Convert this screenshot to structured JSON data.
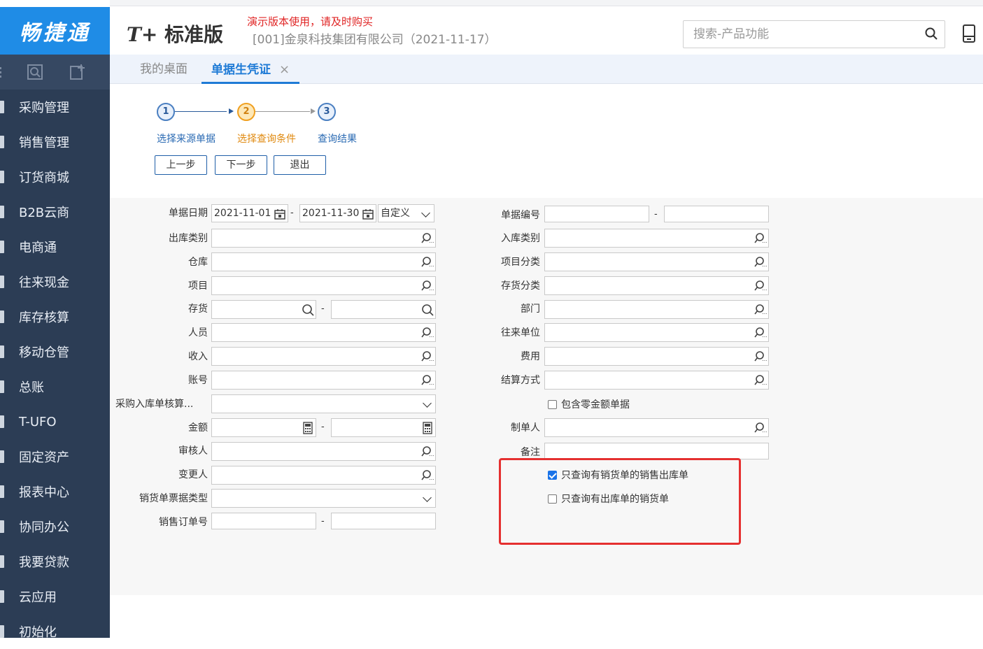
{
  "app": {
    "logo_text": "畅捷通",
    "brand_mark": "T+",
    "brand_name": "标准版",
    "demo_notice": "演示版本使用，请及时购买",
    "company": "[001]金泉科技集团有限公司（2021-11-17）",
    "search_placeholder": "搜索-产品功能"
  },
  "sidebar": {
    "items": [
      {
        "label": "采购管理"
      },
      {
        "label": "销售管理"
      },
      {
        "label": "订货商城"
      },
      {
        "label": "B2B云商"
      },
      {
        "label": "电商通"
      },
      {
        "label": "往来现金"
      },
      {
        "label": "库存核算"
      },
      {
        "label": "移动仓管"
      },
      {
        "label": "总账"
      },
      {
        "label": "T-UFO"
      },
      {
        "label": "固定资产"
      },
      {
        "label": "报表中心"
      },
      {
        "label": "协同办公"
      },
      {
        "label": "我要贷款"
      },
      {
        "label": "云应用"
      },
      {
        "label": "初始化"
      }
    ]
  },
  "tabs": [
    {
      "label": "我的桌面",
      "active": false
    },
    {
      "label": "单据生凭证",
      "active": true,
      "close": "×"
    }
  ],
  "wizard": {
    "steps": [
      {
        "num": "1",
        "label": "选择来源单据"
      },
      {
        "num": "2",
        "label": "选择查询条件"
      },
      {
        "num": "3",
        "label": "查询结果"
      }
    ],
    "current_step": 2,
    "buttons": {
      "prev": "上一步",
      "next": "下一步",
      "exit": "退出"
    }
  },
  "form": {
    "left": {
      "doc_date": {
        "label": "单据日期",
        "from": "2021-11-01",
        "to": "2021-11-30",
        "mode": "自定义"
      },
      "out_type": {
        "label": "出库类别",
        "value": ""
      },
      "warehouse": {
        "label": "仓库",
        "value": ""
      },
      "project": {
        "label": "项目",
        "value": ""
      },
      "inventory": {
        "label": "存货",
        "from": "",
        "to": ""
      },
      "staff": {
        "label": "人员",
        "value": ""
      },
      "income": {
        "label": "收入",
        "value": ""
      },
      "account": {
        "label": "账号",
        "value": ""
      },
      "purchase_check": {
        "label": "采购入库单核算...",
        "value": ""
      },
      "amount": {
        "label": "金额",
        "from": "",
        "to": ""
      },
      "auditor": {
        "label": "审核人",
        "value": ""
      },
      "modifier": {
        "label": "变更人",
        "value": ""
      },
      "invoice_type": {
        "label": "销货单票据类型",
        "value": ""
      },
      "order_no": {
        "label": "销售订单号",
        "from": "",
        "to": ""
      }
    },
    "right": {
      "doc_no": {
        "label": "单据编号",
        "from": "",
        "to": ""
      },
      "in_type": {
        "label": "入库类别",
        "value": ""
      },
      "project_cat": {
        "label": "项目分类",
        "value": ""
      },
      "inventory_cat": {
        "label": "存货分类",
        "value": ""
      },
      "department": {
        "label": "部门",
        "value": ""
      },
      "partner": {
        "label": "往来单位",
        "value": ""
      },
      "expense": {
        "label": "费用",
        "value": ""
      },
      "settlement": {
        "label": "结算方式",
        "value": ""
      },
      "zero_amount": {
        "label": "包含零金额单据",
        "checked": false
      },
      "creator": {
        "label": "制单人",
        "value": ""
      },
      "remark": {
        "label": "备注",
        "value": ""
      },
      "only_sales_out": {
        "label": "只查询有销货单的销售出库单",
        "checked": true
      },
      "only_sales_with_out": {
        "label": "只查询有出库单的销货单",
        "checked": false
      }
    },
    "dash": "-"
  },
  "colors": {
    "logo_bg": "#1f8ce6",
    "sidebar_bg": "#2c3d55",
    "active_tab": "#1f7bd6",
    "demo_red": "#e02424",
    "highlight_box": "#e53030",
    "active_step": "#f0a020"
  }
}
